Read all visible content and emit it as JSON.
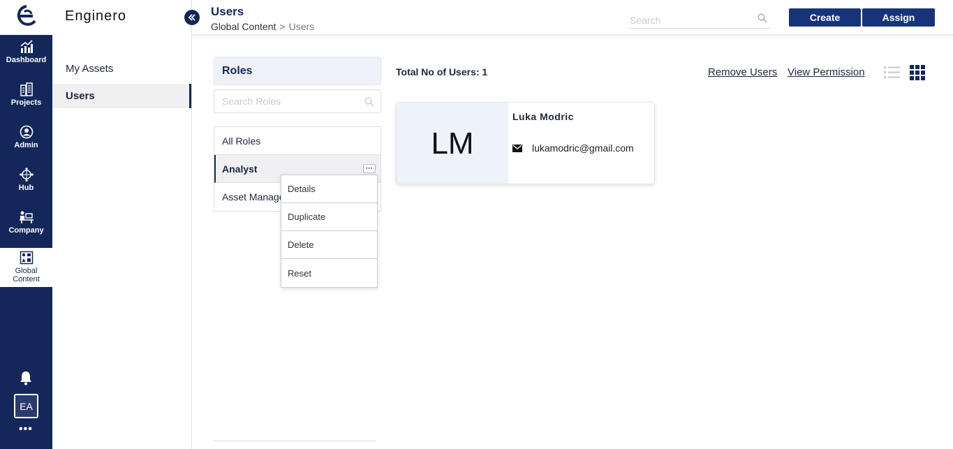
{
  "app": {
    "brand": "Enginero"
  },
  "rail": {
    "items": [
      {
        "label": "Dashboard",
        "icon": "dashboard-chart-icon"
      },
      {
        "label": "Projects",
        "icon": "building-icon"
      },
      {
        "label": "Admin",
        "icon": "admin-user-icon"
      },
      {
        "label": "Hub",
        "icon": "hub-globe-icon"
      },
      {
        "label": "Company",
        "icon": "company-desk-icon"
      },
      {
        "label": "Global Content",
        "icon": "global-content-grid-icon"
      }
    ],
    "avatar": "EA",
    "more": "•••"
  },
  "sidenav": {
    "items": [
      {
        "label": "My Assets"
      },
      {
        "label": "Users"
      }
    ]
  },
  "header": {
    "title": "Users",
    "breadcrumb": {
      "parent": "Global Content",
      "separator": ">",
      "current": "Users"
    },
    "search_placeholder": "Search",
    "create_label": "Create",
    "assign_label": "Assign"
  },
  "roles": {
    "title": "Roles",
    "search_placeholder": "Search Roles",
    "items": [
      {
        "label": "All Roles"
      },
      {
        "label": "Analyst"
      },
      {
        "label": "Asset Manager"
      }
    ],
    "more_label": "···",
    "menu": [
      {
        "label": "Details"
      },
      {
        "label": "Duplicate"
      },
      {
        "label": "Delete"
      },
      {
        "label": "Reset"
      }
    ]
  },
  "users": {
    "total_label": "Total No of Users: 1",
    "remove_label": "Remove Users",
    "permission_label": "View Permission",
    "list": [
      {
        "initials": "LM",
        "name": "Luka Modric",
        "email": "lukamodric@gmail.com"
      }
    ]
  },
  "colors": {
    "navy": "#13275a",
    "button": "#17347a",
    "panel": "#eef2f8"
  }
}
